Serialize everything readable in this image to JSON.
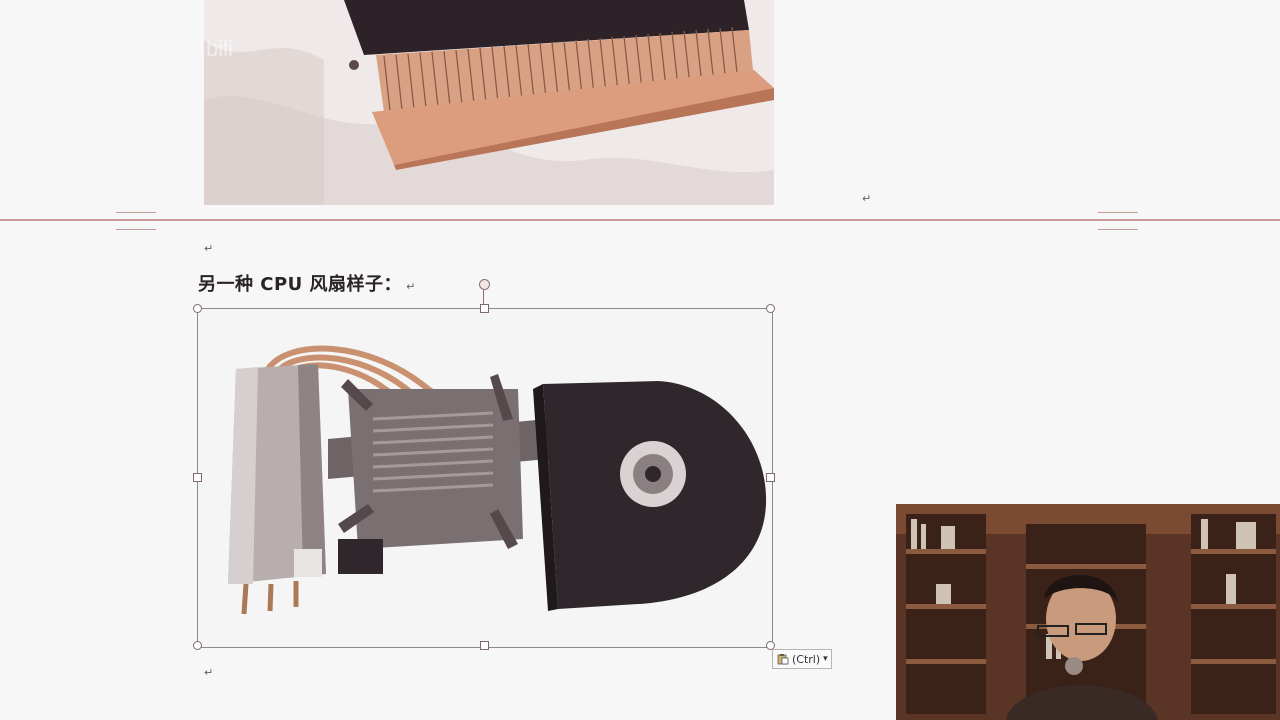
{
  "document": {
    "paragraph_mark": "↵",
    "heading": "另一种 CPU 风扇样子：",
    "top_image_alt": "cpu-heatsink-photo-top",
    "selected_image_alt": "cpu-fan-heatpipe-photo"
  },
  "paste_options": {
    "label": "(Ctrl)",
    "dropdown_arrow": "▾"
  },
  "colors": {
    "page_background": "#f7f7f8",
    "page_break_line": "#c59a99",
    "text": "#2a2325"
  }
}
